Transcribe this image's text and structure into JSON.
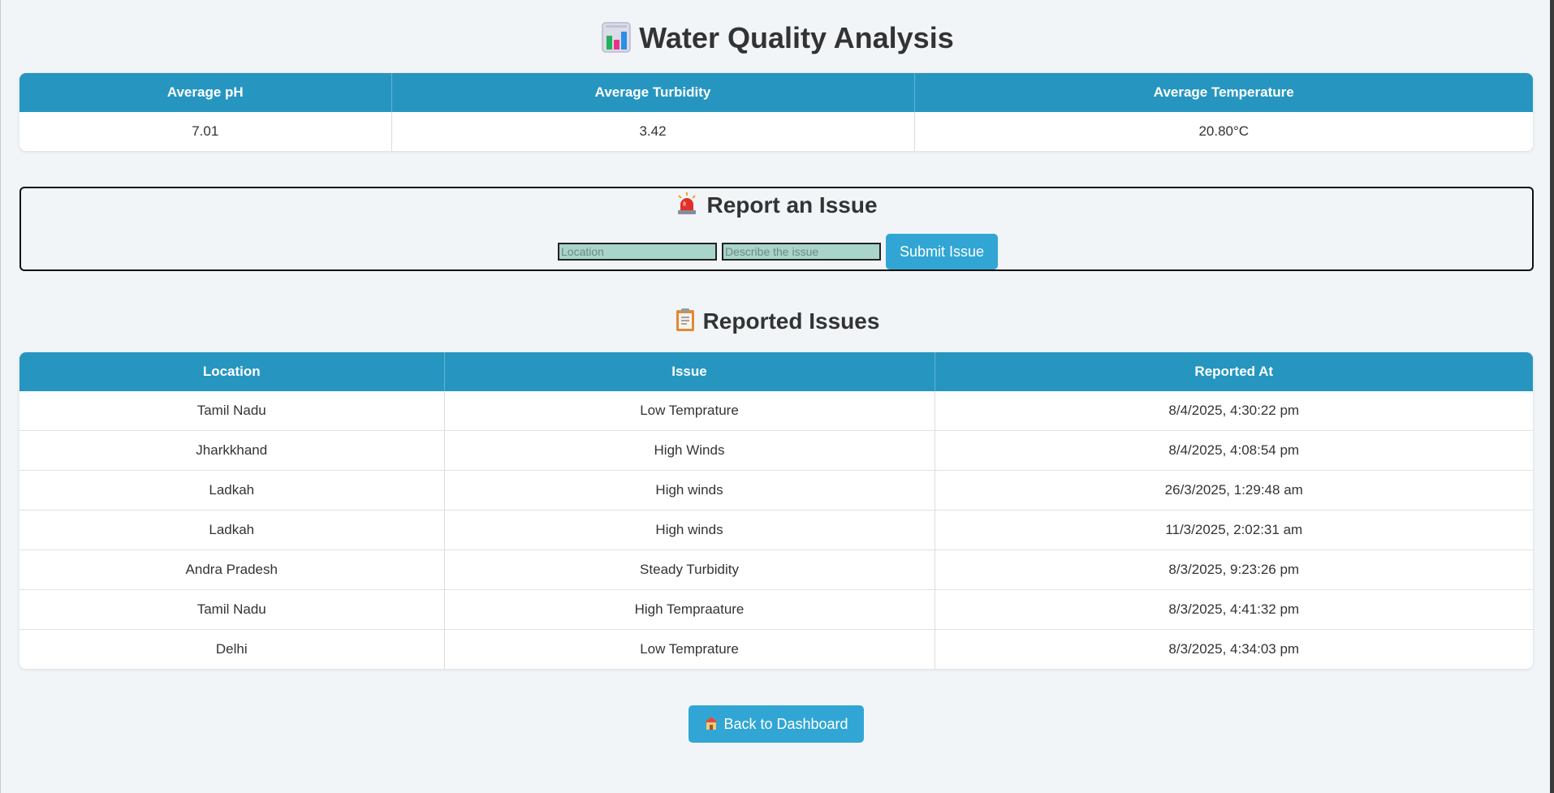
{
  "page": {
    "title": "Water Quality Analysis",
    "title_icon": "bar-chart-icon"
  },
  "averages": {
    "headers": [
      "Average pH",
      "Average Turbidity",
      "Average Temperature"
    ],
    "values": [
      "7.01",
      "3.42",
      "20.80°C"
    ]
  },
  "report": {
    "title": "Report an Issue",
    "title_icon": "siren-icon",
    "location_placeholder": "Location",
    "location_value": "",
    "issue_placeholder": "Describe the issue",
    "issue_value": "",
    "submit_label": "Submit Issue"
  },
  "issues": {
    "title": "Reported Issues",
    "title_icon": "clipboard-icon",
    "headers": [
      "Location",
      "Issue",
      "Reported At"
    ],
    "rows": [
      [
        "Tamil Nadu",
        "Low Temprature",
        "8/4/2025, 4:30:22 pm"
      ],
      [
        "Jharkkhand",
        "High Winds",
        "8/4/2025, 4:08:54 pm"
      ],
      [
        "Ladkah",
        "High winds",
        "26/3/2025, 1:29:48 am"
      ],
      [
        "Ladkah",
        "High winds",
        "11/3/2025, 2:02:31 am"
      ],
      [
        "Andra Pradesh",
        "Steady Turbidity",
        "8/3/2025, 9:23:26 pm"
      ],
      [
        "Tamil Nadu",
        "High Tempraature",
        "8/3/2025, 4:41:32 pm"
      ],
      [
        "Delhi",
        "Low Temprature",
        "8/3/2025, 4:34:03 pm"
      ]
    ]
  },
  "footer": {
    "back_label": "Back to Dashboard",
    "back_icon": "house-icon"
  },
  "colors": {
    "page_background": "#f1f5f8",
    "header_blue": "#2696c0",
    "button_blue": "#31a6d4",
    "input_fill": "#a9d4c9",
    "text": "#333333"
  }
}
